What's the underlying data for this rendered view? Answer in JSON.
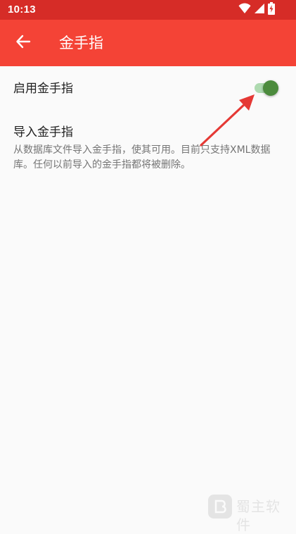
{
  "status_bar": {
    "time": "10:13",
    "icons": [
      "wifi-icon",
      "signal-icon",
      "battery-charging-icon"
    ]
  },
  "app_bar": {
    "title": "金手指",
    "back_icon": "arrow-back-icon"
  },
  "preferences": {
    "enable": {
      "title": "启用金手指",
      "switch_on": true
    },
    "import": {
      "title": "导入金手指",
      "summary": "从数据库文件导入金手指，使其可用。目前只支持XML数据库。任何以前导入的金手指都将被删除。"
    }
  },
  "colors": {
    "status_bar": "#d62c27",
    "app_bar": "#f44336",
    "switch_thumb": "#4c8b3d",
    "switch_track": "#a5d6a7",
    "annotation_arrow": "#e53935"
  },
  "watermark": {
    "text": "蜀主软件"
  }
}
